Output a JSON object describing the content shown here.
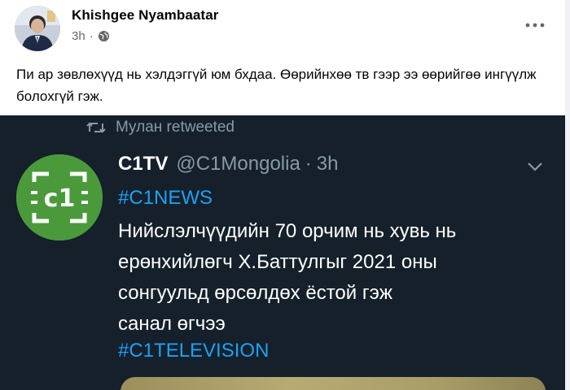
{
  "post": {
    "author": "Khishgee Nyambaatar",
    "time": "3h",
    "separator": "·",
    "privacy_icon": "globe-icon",
    "more_icon": "more-options-icon",
    "text": "Пи ар зөвлөхүүд нь хэлдэггүй юм бхдаа. Өөрийнхөө тв гээр ээ өөрийгөө ингүүлж болохгүй гэж."
  },
  "tweet": {
    "retweet_icon": "retweet-icon",
    "retweeted_by": "Мулан retweeted",
    "display_name": "C1TV",
    "handle": "@C1Mongolia",
    "separator": "·",
    "time": "3h",
    "logo_text": "c1",
    "hashtag_top": "#C1NEWS",
    "body": "Нийслэлчүүдийн 70 орчим нь  хувь нь\nерөнхийлөгч  Х.Баттулгыг 2021 оны\nсонгуульд   өрсөлдөх ёстой  гэж\nсанал өгчээ",
    "hashtag_bottom": "#C1TELEVISION",
    "colors": {
      "background": "#15202b",
      "link": "#1da1f2",
      "muted": "#8899a6",
      "logo_green": "#4a9a3c"
    }
  }
}
